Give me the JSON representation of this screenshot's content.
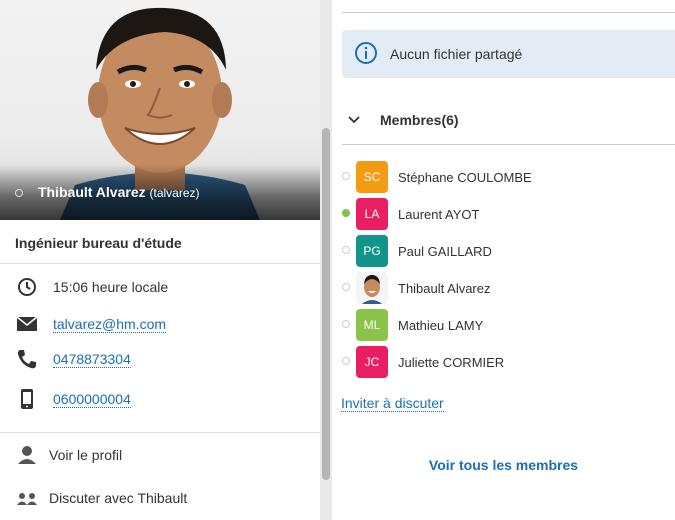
{
  "profile": {
    "name": "Thibault Alvarez",
    "handle": "(talvarez)",
    "job_title": "Ingénieur bureau d'étude",
    "local_time": "15:06 heure locale",
    "email": "talvarez@hm.com",
    "phone": "0478873304",
    "mobile": "0600000004",
    "actions": {
      "view_profile": "Voir le profil",
      "chat_with": "Discuter avec Thibault"
    }
  },
  "files": {
    "empty_message": "Aucun fichier partagé"
  },
  "members": {
    "title": "Membres(6)",
    "list": [
      {
        "initials": "SC",
        "name": "Stéphane COULOMBE",
        "color": "#f39c12",
        "status": "offline"
      },
      {
        "initials": "LA",
        "name": "Laurent AYOT",
        "color": "#e91e63",
        "status": "online"
      },
      {
        "initials": "PG",
        "name": "Paul GAILLARD",
        "color": "#13948a",
        "status": "offline"
      },
      {
        "initials": "",
        "name": "Thibault Alvarez",
        "color": "#ffffff",
        "status": "offline",
        "photo": true
      },
      {
        "initials": "ML",
        "name": "Mathieu LAMY",
        "color": "#8bc34a",
        "status": "offline"
      },
      {
        "initials": "JC",
        "name": "Juliette CORMIER",
        "color": "#e91e63",
        "status": "offline"
      }
    ],
    "invite_label": "Inviter à discuter",
    "see_all_label": "Voir tous les membres"
  }
}
